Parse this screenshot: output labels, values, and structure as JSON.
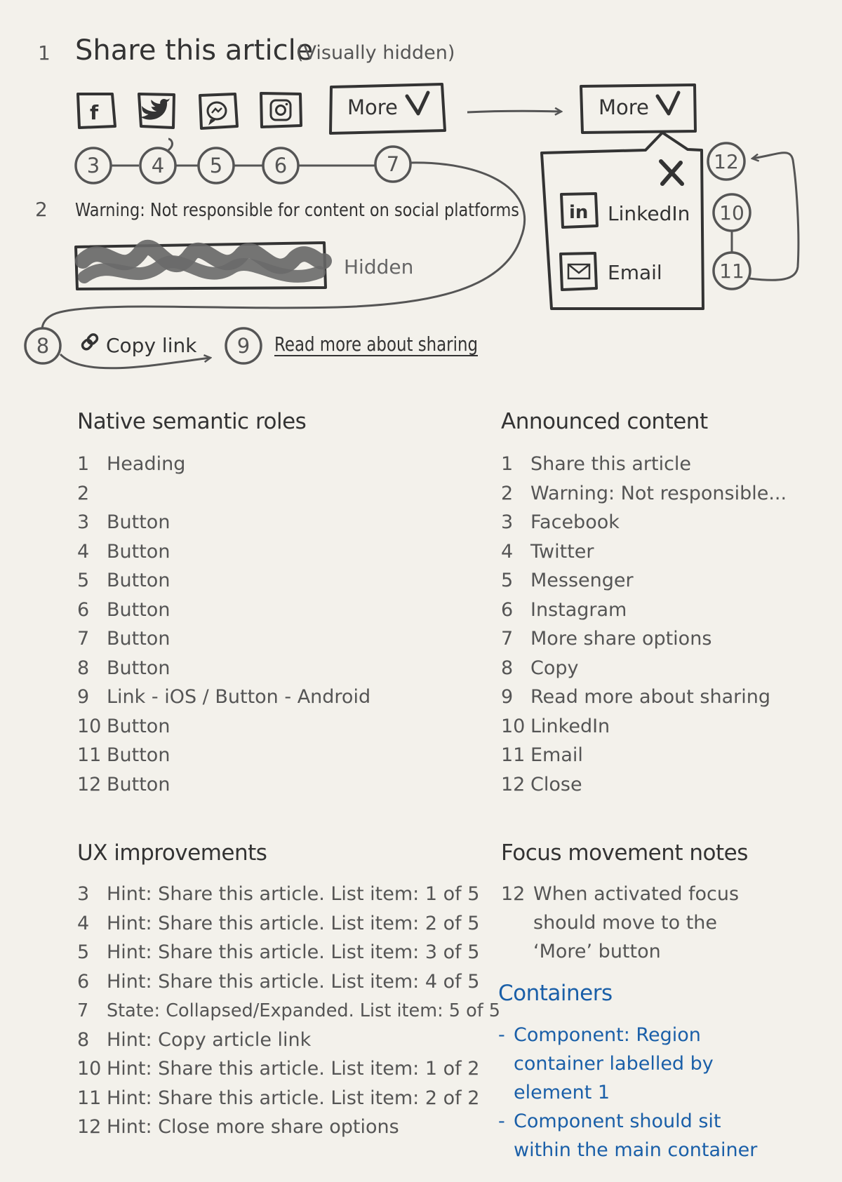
{
  "diagram": {
    "heading_num": "1",
    "heading": "Share this article",
    "heading_note": "(Visually hidden)",
    "social_icons": [
      {
        "name": "facebook-icon",
        "glyph": "f"
      },
      {
        "name": "twitter-icon",
        "glyph": ""
      },
      {
        "name": "messenger-icon",
        "glyph": ""
      },
      {
        "name": "instagram-icon",
        "glyph": ""
      }
    ],
    "more_label": "More",
    "more_popup_label": "More",
    "markers": [
      "3",
      "4",
      "5",
      "6",
      "7",
      "8",
      "9",
      "10",
      "11",
      "12"
    ],
    "warning_num": "2",
    "warning": "Warning: Not responsible for content on social platforms",
    "hidden_label": "Hidden",
    "copy_link": "Copy link",
    "read_more": "Read more about sharing",
    "popup_items": [
      "LinkedIn",
      "Email"
    ],
    "linkedin_glyph": "in"
  },
  "roles": {
    "title": "Native semantic roles",
    "items": [
      {
        "num": "1",
        "text": "Heading"
      },
      {
        "num": "2",
        "text": ""
      },
      {
        "num": "3",
        "text": "Button"
      },
      {
        "num": "4",
        "text": "Button"
      },
      {
        "num": "5",
        "text": "Button"
      },
      {
        "num": "6",
        "text": "Button"
      },
      {
        "num": "7",
        "text": "Button"
      },
      {
        "num": "8",
        "text": "Button"
      },
      {
        "num": "9",
        "text": "Link - iOS / Button - Android"
      },
      {
        "num": "10",
        "text": "Button"
      },
      {
        "num": "11",
        "text": "Button"
      },
      {
        "num": "12",
        "text": "Button"
      }
    ]
  },
  "announced": {
    "title": "Announced content",
    "items": [
      {
        "num": "1",
        "text": "Share this article"
      },
      {
        "num": "2",
        "text": "Warning: Not responsible..."
      },
      {
        "num": "3",
        "text": "Facebook"
      },
      {
        "num": "4",
        "text": "Twitter"
      },
      {
        "num": "5",
        "text": "Messenger"
      },
      {
        "num": "6",
        "text": "Instagram"
      },
      {
        "num": "7",
        "text": "More share options"
      },
      {
        "num": "8",
        "text": "Copy"
      },
      {
        "num": "9",
        "text": "Read more about sharing"
      },
      {
        "num": "10",
        "text": "LinkedIn"
      },
      {
        "num": "11",
        "text": "Email"
      },
      {
        "num": "12",
        "text": "Close"
      }
    ]
  },
  "ux": {
    "title": "UX improvements",
    "items": [
      {
        "num": "3",
        "text": "Hint: Share this article. List item: 1 of 5"
      },
      {
        "num": "4",
        "text": "Hint: Share this article. List item: 2 of 5"
      },
      {
        "num": "5",
        "text": "Hint: Share this article. List item: 3 of 5"
      },
      {
        "num": "6",
        "text": "Hint: Share this article. List item: 4 of 5"
      },
      {
        "num": "7",
        "text": "State: Collapsed/Expanded. List item: 5 of 5"
      },
      {
        "num": "8",
        "text": "Hint: Copy article link"
      },
      {
        "num": "10",
        "text": "Hint: Share this article. List item: 1 of 2"
      },
      {
        "num": "11",
        "text": "Hint: Share this article. List item: 2 of 2"
      },
      {
        "num": "12",
        "text": "Hint: Close more share options"
      }
    ]
  },
  "focus": {
    "title": "Focus movement notes",
    "num": "12",
    "text": "When activated focus should move to the ‘More’ button"
  },
  "containers": {
    "title": "Containers",
    "items": [
      "Component: Region container labelled by element 1",
      "Component should sit within the main container"
    ]
  },
  "colors": {
    "ink": "#333333",
    "grey_text": "#555555",
    "blue": "#1a5fa8",
    "paper": "#f3f1eb"
  }
}
